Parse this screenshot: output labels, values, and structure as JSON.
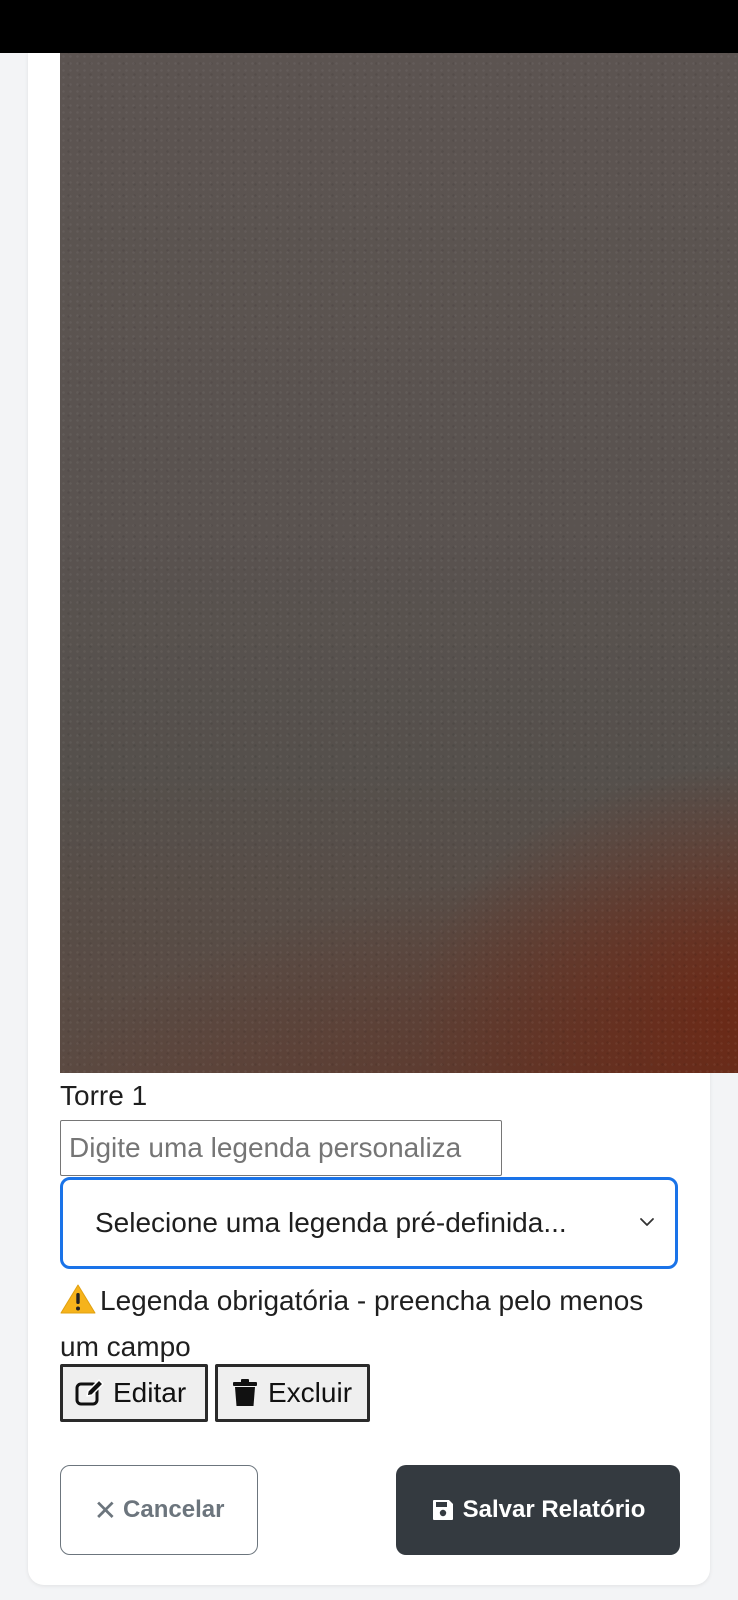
{
  "photo": {
    "label": "Torre 1"
  },
  "caption": {
    "custom_placeholder": "Digite uma legenda personaliza",
    "select_value": "Selecione uma legenda pré-definida..."
  },
  "warning": {
    "icon": "warning-icon",
    "text": "Legenda obrigatória - preencha pelo menos um campo"
  },
  "photo_actions": {
    "edit_label": "Editar",
    "delete_label": "Excluir"
  },
  "footer": {
    "cancel_label": "Cancelar",
    "save_label": "Salvar Relatório"
  },
  "colors": {
    "select_focus_border": "#1a73e8",
    "save_button_bg": "#343a40",
    "cancel_text": "#6c757d"
  }
}
